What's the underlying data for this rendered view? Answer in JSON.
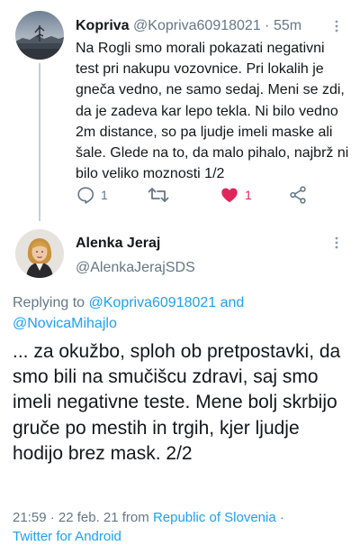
{
  "colors": {
    "link": "#1da1f2",
    "secondary_text": "#657786",
    "like": "#e0245e",
    "thread_line": "#c4cfd6"
  },
  "parent_tweet": {
    "author_name": "Kopriva",
    "author_handle": "@Kopriva60918021",
    "separator": "·",
    "time": "55m",
    "text": "Na Rogli smo morali pokazati negativni test pri nakupu vozovnice. Pri lokalih je gneča vedno, ne samo sedaj. Meni se zdi, da je zadeva kar lepo tekla. Ni bilo vedno 2m distance, so pa ljudje imeli maske ali šale. Glede na to, da malo pihalo, najbrž ni bilo veliko moznosti 1/2",
    "actions": {
      "reply_count": "1",
      "retweet_count": "",
      "like_count": "1",
      "liked": true
    },
    "icons": [
      "more-icon",
      "reply-icon",
      "retweet-icon",
      "heart-icon",
      "share-icon"
    ]
  },
  "focused_tweet": {
    "author_name": "Alenka Jeraj",
    "author_handle": "@AlenkaJerajSDS",
    "replying_prefix": "Replying to ",
    "replying_to_1": "@Kopriva60918021",
    "replying_and": " and",
    "replying_to_2": "@NovicaMihajlo",
    "text": "... za okužbo, sploh ob pretpostavki, da smo bili na smučišcu zdravi, saj smo imeli negativne teste. Mene bolj skrbijo gruče po mestih in trgih, kjer ljudje hodijo brez mask. 2/2",
    "meta_time": "21:59 · 22 feb. 21 from ",
    "meta_location": "Republic of Slovenia",
    "meta_sep": " · ",
    "meta_client": "Twitter for Android"
  }
}
